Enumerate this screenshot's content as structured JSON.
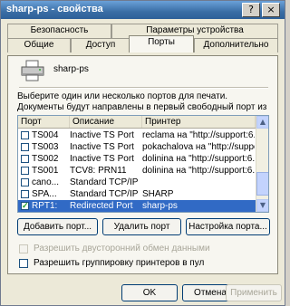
{
  "window": {
    "title": "sharp-ps - свойства",
    "help_label": "?",
    "close_label": "×"
  },
  "tabs": {
    "row1": [
      "Безопасность",
      "Параметры устройства"
    ],
    "row2": [
      "Общие",
      "Доступ",
      "Порты",
      "Дополнительно"
    ],
    "active": "Порты"
  },
  "printer": {
    "name": "sharp-ps",
    "icon": "printer-icon"
  },
  "description": "Выберите один или несколько портов для печати. Документы будут направлены в первый свободный порт из отмеченных в списке.",
  "ports_table": {
    "headers": [
      "Порт",
      "Описание",
      "Принтер"
    ],
    "rows": [
      {
        "checked": false,
        "port": "TS004",
        "desc": "Inactive TS Port",
        "printer": "reclama на \"http://support:6...",
        "selected": false
      },
      {
        "checked": false,
        "port": "TS003",
        "desc": "Inactive TS Port",
        "printer": "pokachalova на \"http://support:...",
        "selected": false
      },
      {
        "checked": false,
        "port": "TS002",
        "desc": "Inactive TS Port",
        "printer": "dolinina на \"http://support:6...",
        "selected": false
      },
      {
        "checked": false,
        "port": "TS001",
        "desc": "TCV8: PRN11",
        "printer": "dolinina на \"http://support:6...",
        "selected": false
      },
      {
        "checked": false,
        "port": "cano...",
        "desc": "Standard TCP/IP Port",
        "printer": "",
        "selected": false
      },
      {
        "checked": false,
        "port": "SPA...",
        "desc": "Standard TCP/IP Port",
        "printer": "SHARP",
        "selected": false
      },
      {
        "checked": true,
        "port": "RPT1:",
        "desc": "Redirected Port",
        "printer": "sharp-ps",
        "selected": true
      }
    ]
  },
  "buttons": {
    "add_port": "Добавить порт...",
    "delete_port": "Удалить порт",
    "configure_port": "Настройка порта..."
  },
  "options": {
    "bidirectional": {
      "label": "Разрешить двусторонний обмен данными",
      "checked": false,
      "enabled": false
    },
    "pooling": {
      "label": "Разрешить группировку принтеров в пул",
      "checked": false,
      "enabled": true
    }
  },
  "dialog_buttons": {
    "ok": "OK",
    "cancel": "Отмена",
    "apply": "Применить"
  },
  "colors": {
    "selection": "#316ac5",
    "title_bar": "#3a6ea5"
  }
}
